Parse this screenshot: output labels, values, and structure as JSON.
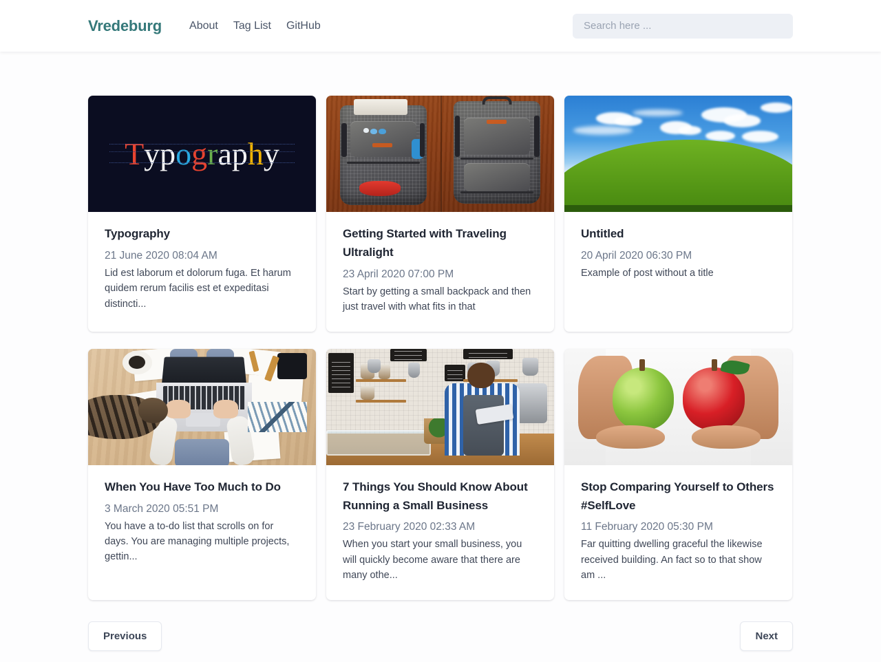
{
  "header": {
    "brand": "Vredeburg",
    "brand_color": "#35797a",
    "nav": [
      {
        "label": "About"
      },
      {
        "label": "Tag List"
      },
      {
        "label": "GitHub"
      }
    ],
    "search": {
      "placeholder": "Search here ...",
      "value": ""
    }
  },
  "posts": [
    {
      "title": "Typography",
      "date": "21 June 2020 08:04 AM",
      "excerpt": "Lid est laborum et dolorum fuga. Et harum quidem rerum facilis est et expeditasi distincti...",
      "image_alt": "typography-poster-image",
      "image_word": "Typography"
    },
    {
      "title": "Getting Started with Traveling Ultralight",
      "date": "23 April 2020 07:00 PM",
      "excerpt": "Start by getting a small backpack and then just travel with what fits in that",
      "image_alt": "two-backpacks-on-wood-image"
    },
    {
      "title": "Untitled",
      "date": "20 April 2020 06:30 PM",
      "excerpt": "Example of post without a title",
      "image_alt": "green-hill-blue-sky-image"
    },
    {
      "title": "When You Have Too Much to Do",
      "date": "3 March 2020 05:51 PM",
      "excerpt": "You have a to-do list that scrolls on for days. You are managing multiple projects, gettin...",
      "image_alt": "desk-flatlay-laptop-cat-image"
    },
    {
      "title": "7 Things You Should Know About Running a Small Business",
      "date": "23 February 2020 02:33 AM",
      "excerpt": "When you start your small business, you will quickly become aware that there are many othe...",
      "image_alt": "coffee-shop-owner-with-tablet-image"
    },
    {
      "title": "Stop Comparing Yourself to Others #SelfLove",
      "date": "11 February 2020 05:30 PM",
      "excerpt": "Far quitting dwelling graceful the likewise received building. An fact so to that show am ...",
      "image_alt": "hands-holding-green-and-red-apple-image"
    }
  ],
  "pagination": {
    "previous_label": "Previous",
    "next_label": "Next"
  }
}
